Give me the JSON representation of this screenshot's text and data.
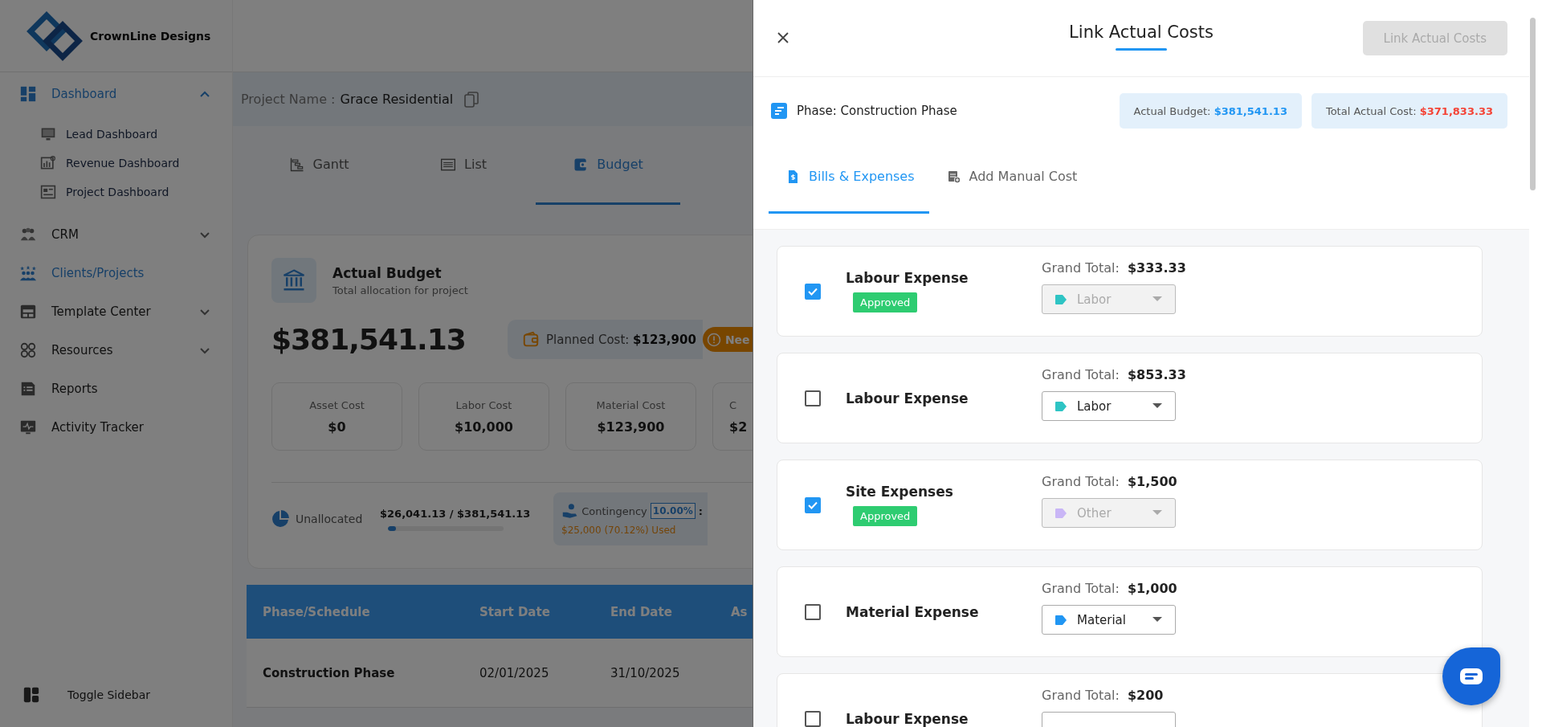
{
  "sidebar": {
    "logo_text": "CrownLine Designs",
    "items": [
      {
        "label": "Dashboard",
        "selected": true,
        "expanded": true,
        "children": [
          {
            "label": "Lead Dashboard"
          },
          {
            "label": "Revenue Dashboard"
          },
          {
            "label": "Project Dashboard"
          }
        ]
      },
      {
        "label": "CRM",
        "selected": false,
        "expanded": false
      },
      {
        "label": "Clients/Projects",
        "selected": true
      },
      {
        "label": "Template Center",
        "selected": false,
        "expanded": false
      },
      {
        "label": "Resources",
        "selected": false,
        "expanded": false
      },
      {
        "label": "Reports",
        "selected": false
      },
      {
        "label": "Activity Tracker",
        "selected": false
      }
    ],
    "toggle_label": "Toggle Sidebar"
  },
  "main": {
    "project_label": "Project Name :",
    "project_name": "Grace Residential",
    "view_tabs": [
      {
        "label": "Gantt",
        "selected": false
      },
      {
        "label": "List",
        "selected": false
      },
      {
        "label": "Budget",
        "selected": true
      }
    ],
    "budget": {
      "title": "Actual Budget",
      "subtitle": "Total allocation for project",
      "amount": "$381,541.13",
      "planned_label": "Planned Cost:",
      "planned_value": "$123,900",
      "badge": "Nee",
      "cost_cards": [
        {
          "label": "Asset Cost",
          "value": "$0"
        },
        {
          "label": "Labor Cost",
          "value": "$10,000"
        },
        {
          "label": "Material Cost",
          "value": "$123,900"
        },
        {
          "label": "C",
          "value": "$2"
        }
      ],
      "unallocated": {
        "label": "Unallocated",
        "amount": "$26,041.13 / $381,541.13",
        "level": 0.07
      },
      "contingency": {
        "label": "Contingency",
        "percent": "10.00%",
        "suffix": ":",
        "used": "$25,000 (70.12%) Used"
      }
    },
    "table": {
      "columns": [
        "Phase/Schedule",
        "Start Date",
        "End Date",
        "As"
      ],
      "rows": [
        [
          "Construction Phase",
          "02/01/2025",
          "31/10/2025"
        ]
      ]
    }
  },
  "panel": {
    "title": "Link Actual Costs",
    "action": {
      "label": "Link Actual Costs",
      "disabled": true
    },
    "phase": "Phase: Construction Phase",
    "chips": [
      {
        "label": "Actual Budget:",
        "value": "$381,541.13",
        "color": "#2196f3"
      },
      {
        "label": "Total Actual Cost:",
        "value": "$371,833.33",
        "color": "#f44336"
      }
    ],
    "tabs": [
      {
        "label": "Bills & Expenses",
        "selected": true
      },
      {
        "label": "Add Manual Cost",
        "selected": false
      }
    ],
    "expenses": [
      {
        "name": "Labour Expense",
        "checked": true,
        "status": "Approved",
        "total_label": "Grand Total:",
        "total": "$333.33",
        "category": {
          "label": "Labor",
          "color": "#2ec4c4",
          "disabled": true
        }
      },
      {
        "name": "Labour Expense",
        "checked": false,
        "total_label": "Grand Total:",
        "total": "$853.33",
        "category": {
          "label": "Labor",
          "color": "#2ec4c4",
          "disabled": false
        }
      },
      {
        "name": "Site Expenses",
        "checked": true,
        "status": "Approved",
        "total_label": "Grand Total:",
        "total": "$1,500",
        "category": {
          "label": "Other",
          "color": "#c9b6f6",
          "disabled": true
        }
      },
      {
        "name": "Material Expense",
        "checked": false,
        "total_label": "Grand Total:",
        "total": "$1,000",
        "category": {
          "label": "Material",
          "color": "#2196f3",
          "disabled": false
        }
      },
      {
        "name": "Labour Expense",
        "checked": false,
        "total_label": "Grand Total:",
        "total": "$200"
      }
    ]
  }
}
